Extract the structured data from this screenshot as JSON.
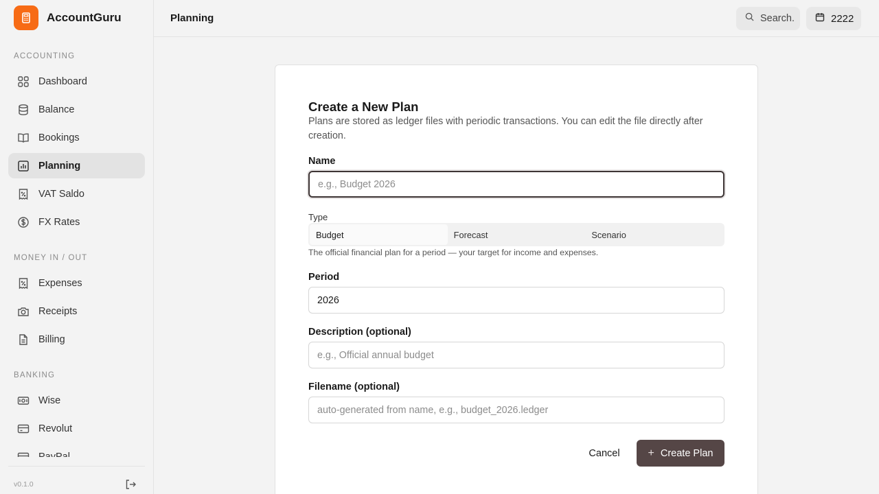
{
  "app": {
    "name": "AccountGuru",
    "version": "v0.1.0",
    "brand_color": "#f76b15"
  },
  "sidebar": {
    "sections": [
      {
        "title": "ACCOUNTING",
        "items": [
          {
            "label": "Dashboard",
            "icon": "dashboard-grid-icon"
          },
          {
            "label": "Balance",
            "icon": "database-icon"
          },
          {
            "label": "Bookings",
            "icon": "book-icon"
          },
          {
            "label": "Planning",
            "icon": "chart-icon",
            "active": true
          },
          {
            "label": "VAT Saldo",
            "icon": "receipt-percent-icon"
          },
          {
            "label": "FX Rates",
            "icon": "dollar-circle-icon"
          }
        ]
      },
      {
        "title": "MONEY IN / OUT",
        "items": [
          {
            "label": "Expenses",
            "icon": "receipt-icon"
          },
          {
            "label": "Receipts",
            "icon": "camera-icon"
          },
          {
            "label": "Billing",
            "icon": "document-icon"
          }
        ]
      },
      {
        "title": "BANKING",
        "items": [
          {
            "label": "Wise",
            "icon": "banknote-icon"
          },
          {
            "label": "Revolut",
            "icon": "credit-card-icon"
          },
          {
            "label": "PayPal",
            "icon": "credit-card-icon"
          }
        ]
      }
    ]
  },
  "header": {
    "title": "Planning",
    "search_label": "Search.",
    "year": "2222"
  },
  "form": {
    "title": "Create a New Plan",
    "subtitle": "Plans are stored as ledger files with periodic transactions. You can edit the file directly after creation.",
    "name": {
      "label": "Name",
      "placeholder": "e.g., Budget 2026",
      "value": ""
    },
    "type": {
      "label": "Type",
      "options": [
        "Budget",
        "Forecast",
        "Scenario"
      ],
      "selected": "Budget",
      "help": "The official financial plan for a period — your target for income and expenses."
    },
    "period": {
      "label": "Period",
      "value": "2026"
    },
    "description": {
      "label": "Description (optional)",
      "placeholder": "e.g., Official annual budget"
    },
    "filename": {
      "label": "Filename (optional)",
      "placeholder": "auto-generated from name, e.g., budget_2026.ledger"
    },
    "cancel_label": "Cancel",
    "submit_label": "Create Plan"
  }
}
